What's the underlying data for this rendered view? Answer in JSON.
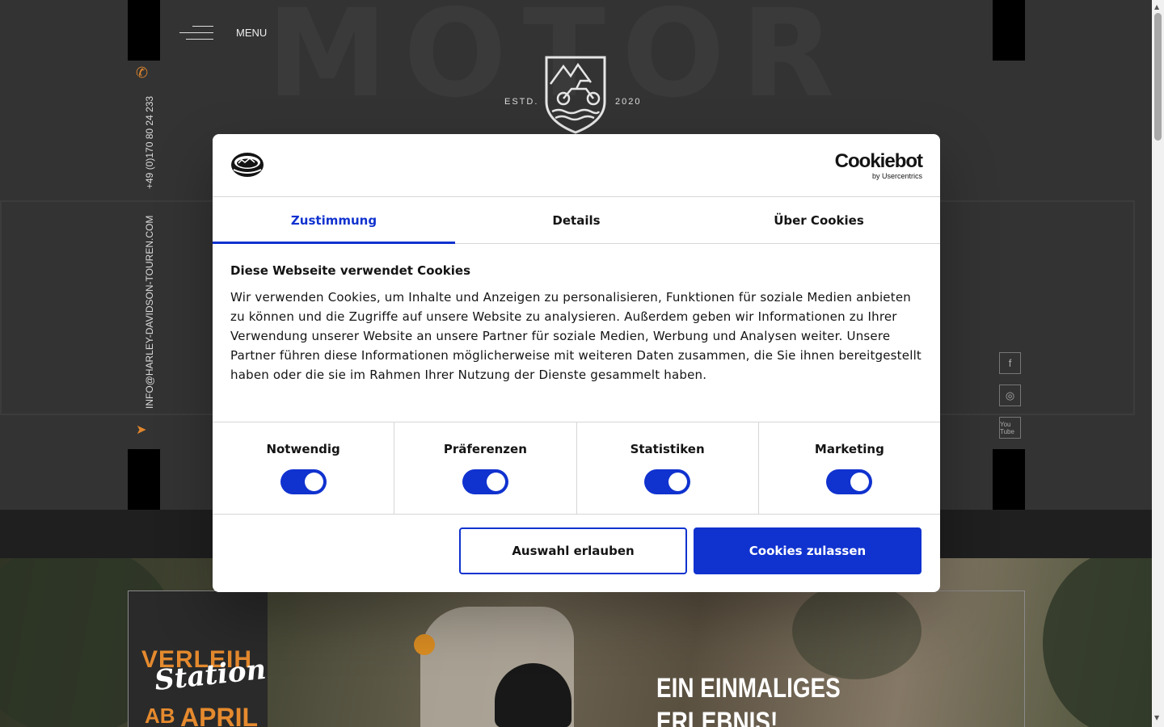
{
  "site": {
    "menu_label": "MENU",
    "logo": {
      "estd": "ESTD.",
      "year": "2020"
    },
    "contact": {
      "phone": "+49 (0)170 80 24 233",
      "email": "INFO@HARLEY-DAVIDSON-TOUREN.COM"
    },
    "social": {
      "facebook": "f",
      "instagram": "◎",
      "youtube": "You Tube"
    },
    "promo": {
      "line1": "VERLEIH",
      "line2": "Station",
      "line3a": "AB",
      "line3b": "APRIL"
    },
    "headline_1": "EIN EINMALIGES",
    "headline_2": "ERLEBNIS!"
  },
  "cookie_dialog": {
    "brand_name": "Cookiebot",
    "brand_sub": "by Usercentrics",
    "tabs": [
      {
        "label": "Zustimmung",
        "active": true
      },
      {
        "label": "Details",
        "active": false
      },
      {
        "label": "Über Cookies",
        "active": false
      }
    ],
    "title": "Diese Webseite verwendet Cookies",
    "text": "Wir verwenden Cookies, um Inhalte und Anzeigen zu personalisieren, Funktionen für soziale Medien anbieten zu können und die Zugriffe auf unsere Website zu analysieren. Außerdem geben wir Informationen zu Ihrer Verwendung unserer Website an unsere Partner für soziale Medien, Werbung und Analysen weiter. Unsere Partner führen diese Informationen möglicherweise mit weiteren Daten zusammen, die Sie ihnen bereitgestellt haben oder die sie im Rahmen Ihrer Nutzung der Dienste gesammelt haben.",
    "categories": [
      {
        "label": "Notwendig",
        "enabled": true
      },
      {
        "label": "Präferenzen",
        "enabled": true
      },
      {
        "label": "Statistiken",
        "enabled": true
      },
      {
        "label": "Marketing",
        "enabled": true
      }
    ],
    "btn_allow_selection": "Auswahl erlauben",
    "btn_allow_all": "Cookies zulassen",
    "accent_color": "#1032cf"
  },
  "colors": {
    "brand_orange": "#e0862c",
    "dialog_accent": "#1032cf"
  }
}
